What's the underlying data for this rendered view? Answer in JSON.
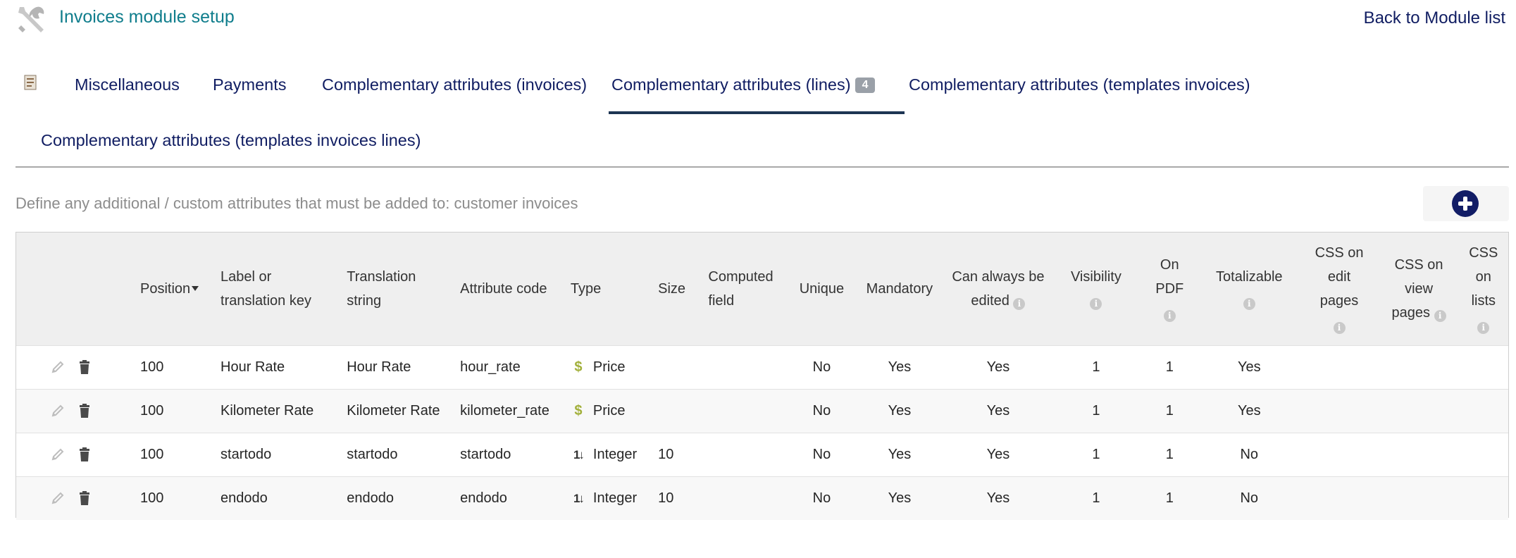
{
  "header": {
    "title": "Invoices module setup",
    "back_link": "Back to Module list",
    "icon": "tools-icon"
  },
  "tabs": [
    {
      "label": "Miscellaneous",
      "active": false
    },
    {
      "label": "Payments",
      "active": false
    },
    {
      "label": "Complementary attributes (invoices)",
      "active": false
    },
    {
      "label": "Complementary attributes (lines)",
      "active": true,
      "badge": "4"
    },
    {
      "label": "Complementary attributes (templates invoices)",
      "active": false
    },
    {
      "label": "Complementary attributes (templates invoices lines)",
      "active": false
    }
  ],
  "description": "Define any additional / custom attributes that must be added to: customer invoices",
  "table": {
    "columns": {
      "position": "Position",
      "label_1": "Label or",
      "label_2": "translation key",
      "translation_1": "Translation",
      "translation_2": "string",
      "code": "Attribute code",
      "type": "Type",
      "size": "Size",
      "computed_1": "Computed",
      "computed_2": "field",
      "unique": "Unique",
      "mandatory": "Mandatory",
      "always_edit_1": "Can always be",
      "always_edit_2": "edited",
      "visibility": "Visibility",
      "onpdf_1": "On",
      "onpdf_2": "PDF",
      "totalizable": "Totalizable",
      "css_edit_1": "CSS on",
      "css_edit_2": "edit",
      "css_edit_3": "pages",
      "css_view_1": "CSS on",
      "css_view_2": "view",
      "css_view_3": "pages",
      "css_list_1": "CSS",
      "css_list_2": "on",
      "css_list_3": "lists"
    },
    "info_glyph": "i",
    "rows": [
      {
        "position": "100",
        "label": "Hour Rate",
        "translation": "Hour Rate",
        "code": "hour_rate",
        "type_icon": "$",
        "type": "Price",
        "size": "",
        "computed": "",
        "unique": "No",
        "mandatory": "Yes",
        "always_edit": "Yes",
        "visibility": "1",
        "on_pdf": "1",
        "totalizable": "Yes",
        "css_edit": "",
        "css_view": "",
        "css_list": ""
      },
      {
        "position": "100",
        "label": "Kilometer Rate",
        "translation": "Kilometer Rate",
        "code": "kilometer_rate",
        "type_icon": "$",
        "type": "Price",
        "size": "",
        "computed": "",
        "unique": "No",
        "mandatory": "Yes",
        "always_edit": "Yes",
        "visibility": "1",
        "on_pdf": "1",
        "totalizable": "Yes",
        "css_edit": "",
        "css_view": "",
        "css_list": ""
      },
      {
        "position": "100",
        "label": "startodo",
        "translation": "startodo",
        "code": "startodo",
        "type_icon": "1↓",
        "type": "Integer",
        "size": "10",
        "computed": "",
        "unique": "No",
        "mandatory": "Yes",
        "always_edit": "Yes",
        "visibility": "1",
        "on_pdf": "1",
        "totalizable": "No",
        "css_edit": "",
        "css_view": "",
        "css_list": ""
      },
      {
        "position": "100",
        "label": "endodo",
        "translation": "endodo",
        "code": "endodo",
        "type_icon": "1↓",
        "type": "Integer",
        "size": "10",
        "computed": "",
        "unique": "No",
        "mandatory": "Yes",
        "always_edit": "Yes",
        "visibility": "1",
        "on_pdf": "1",
        "totalizable": "No",
        "css_edit": "",
        "css_view": "",
        "css_list": ""
      }
    ]
  },
  "colors": {
    "title": "#0f7d8c",
    "link": "#101d62",
    "price_icon": "#a2b03b",
    "add_button": "#121d66"
  }
}
